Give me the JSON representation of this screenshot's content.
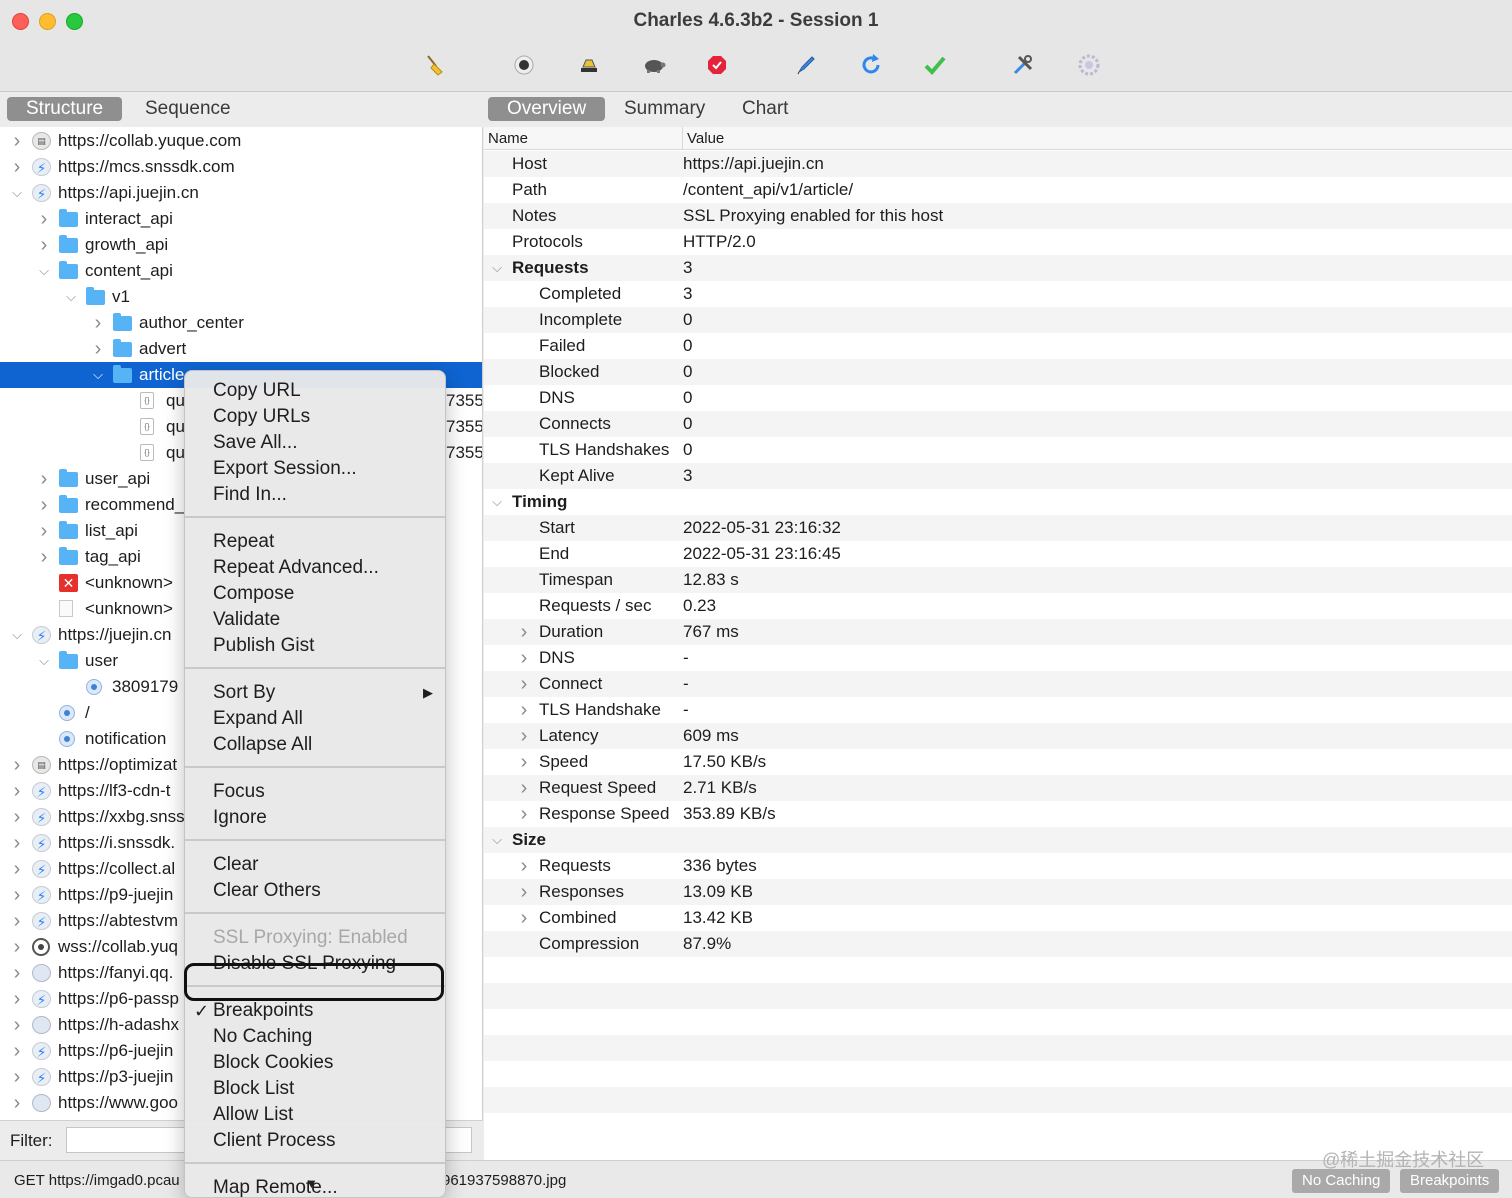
{
  "window": {
    "title": "Charles 4.6.3b2 - Session 1"
  },
  "toolbar": {
    "icons": [
      "broom-icon",
      "record-icon",
      "throttle-icon",
      "turtle-icon",
      "breakpoint-stop-icon",
      "pen-icon",
      "refresh-icon",
      "check-icon",
      "tools-icon",
      "gear-icon"
    ]
  },
  "left_tabs": [
    "Structure",
    "Sequence"
  ],
  "right_tabs": [
    "Overview",
    "Summary",
    "Chart"
  ],
  "tree": [
    {
      "label": "https://collab.yuque.com",
      "icon": "lock-icon",
      "level": 0,
      "chev": ">"
    },
    {
      "label": "https://mcs.snssdk.com",
      "icon": "bolt-icon",
      "level": 0,
      "chev": ">"
    },
    {
      "label": "https://api.juejin.cn",
      "icon": "bolt-icon",
      "level": 0,
      "chev": "v"
    },
    {
      "label": "interact_api",
      "icon": "folder-icon",
      "level": 1,
      "chev": ">"
    },
    {
      "label": "growth_api",
      "icon": "folder-icon",
      "level": 1,
      "chev": ">"
    },
    {
      "label": "content_api",
      "icon": "folder-icon",
      "level": 1,
      "chev": "v"
    },
    {
      "label": "v1",
      "icon": "folder-icon",
      "level": 2,
      "chev": "v"
    },
    {
      "label": "author_center",
      "icon": "folder-icon",
      "level": 3,
      "chev": ">"
    },
    {
      "label": "advert",
      "icon": "folder-icon",
      "level": 3,
      "chev": ">"
    },
    {
      "label": "article",
      "icon": "folder-icon",
      "level": 3,
      "chev": "v",
      "selected": true
    },
    {
      "label": "qu",
      "icon": "json-doc-icon",
      "level": 4,
      "chev": "",
      "trail": "7355"
    },
    {
      "label": "qu",
      "icon": "json-doc-icon",
      "level": 4,
      "chev": "",
      "trail": "7355"
    },
    {
      "label": "qu",
      "icon": "json-doc-icon",
      "level": 4,
      "chev": "",
      "trail": "7355"
    },
    {
      "label": "user_api",
      "icon": "folder-icon",
      "level": 1,
      "chev": ">"
    },
    {
      "label": "recommend_",
      "icon": "folder-icon",
      "level": 1,
      "chev": ">"
    },
    {
      "label": "list_api",
      "icon": "folder-icon",
      "level": 1,
      "chev": ">"
    },
    {
      "label": "tag_api",
      "icon": "folder-icon",
      "level": 1,
      "chev": ">"
    },
    {
      "label": "<unknown>",
      "icon": "error-icon",
      "level": 1,
      "chev": ""
    },
    {
      "label": "<unknown>",
      "icon": "blank-doc-icon",
      "level": 1,
      "chev": ""
    },
    {
      "label": "https://juejin.cn",
      "icon": "bolt-icon",
      "level": 0,
      "chev": "v"
    },
    {
      "label": "user",
      "icon": "folder-icon",
      "level": 1,
      "chev": "v"
    },
    {
      "label": "3809179",
      "icon": "request-dot-icon",
      "level": 2,
      "chev": ""
    },
    {
      "label": "/",
      "icon": "request-dot-icon",
      "level": 1,
      "chev": ""
    },
    {
      "label": "notification",
      "icon": "request-dot-icon",
      "level": 1,
      "chev": ""
    },
    {
      "label": "https://optimizat",
      "icon": "lock-icon",
      "level": 0,
      "chev": ">"
    },
    {
      "label": "https://lf3-cdn-t",
      "icon": "bolt-icon",
      "level": 0,
      "chev": ">"
    },
    {
      "label": "https://xxbg.snss",
      "icon": "bolt-icon",
      "level": 0,
      "chev": ">"
    },
    {
      "label": "https://i.snssdk.",
      "icon": "bolt-icon",
      "level": 0,
      "chev": ">"
    },
    {
      "label": "https://collect.al",
      "icon": "bolt-icon",
      "level": 0,
      "chev": ">"
    },
    {
      "label": "https://p9-juejin",
      "icon": "bolt-icon",
      "level": 0,
      "chev": ">"
    },
    {
      "label": "https://abtestvm",
      "icon": "bolt-icon",
      "level": 0,
      "chev": ">"
    },
    {
      "label": "wss://collab.yuq",
      "icon": "websocket-icon",
      "level": 0,
      "chev": ">"
    },
    {
      "label": "https://fanyi.qq.",
      "icon": "globe-icon",
      "level": 0,
      "chev": ">"
    },
    {
      "label": "https://p6-passp",
      "icon": "bolt-icon",
      "level": 0,
      "chev": ">"
    },
    {
      "label": "https://h-adashx",
      "icon": "globe-icon",
      "level": 0,
      "chev": ">"
    },
    {
      "label": "https://p6-juejin",
      "icon": "bolt-icon",
      "level": 0,
      "chev": ">"
    },
    {
      "label": "https://p3-juejin",
      "icon": "bolt-icon",
      "level": 0,
      "chev": ">"
    },
    {
      "label": "https://www.goo",
      "icon": "globe-icon",
      "level": 0,
      "chev": ">"
    }
  ],
  "filter": {
    "label": "Filter:",
    "value": ""
  },
  "overview": {
    "col_name": "Name",
    "col_value": "Value",
    "rows": [
      {
        "name": "Host",
        "value": "https://api.juejin.cn",
        "level": 0
      },
      {
        "name": "Path",
        "value": "/content_api/v1/article/",
        "level": 0
      },
      {
        "name": "Notes",
        "value": "SSL Proxying enabled for this host",
        "level": 0
      },
      {
        "name": "Protocols",
        "value": "HTTP/2.0",
        "level": 0
      },
      {
        "name": "Requests",
        "value": "3",
        "level": 0,
        "group": true,
        "chev": "v"
      },
      {
        "name": "Completed",
        "value": "3",
        "level": 1
      },
      {
        "name": "Incomplete",
        "value": "0",
        "level": 1
      },
      {
        "name": "Failed",
        "value": "0",
        "level": 1
      },
      {
        "name": "Blocked",
        "value": "0",
        "level": 1
      },
      {
        "name": "DNS",
        "value": "0",
        "level": 1
      },
      {
        "name": "Connects",
        "value": "0",
        "level": 1
      },
      {
        "name": "TLS Handshakes",
        "value": "0",
        "level": 1
      },
      {
        "name": "Kept Alive",
        "value": "3",
        "level": 1
      },
      {
        "name": "Timing",
        "value": "",
        "level": 0,
        "group": true,
        "chev": "v"
      },
      {
        "name": "Start",
        "value": "2022-05-31 23:16:32",
        "level": 1
      },
      {
        "name": "End",
        "value": "2022-05-31 23:16:45",
        "level": 1
      },
      {
        "name": "Timespan",
        "value": "12.83 s",
        "level": 1
      },
      {
        "name": "Requests / sec",
        "value": "0.23",
        "level": 1
      },
      {
        "name": "Duration",
        "value": "767 ms",
        "level": 1,
        "chev": ">"
      },
      {
        "name": "DNS",
        "value": "-",
        "level": 1,
        "chev": ">"
      },
      {
        "name": "Connect",
        "value": "-",
        "level": 1,
        "chev": ">"
      },
      {
        "name": "TLS Handshake",
        "value": "-",
        "level": 1,
        "chev": ">"
      },
      {
        "name": "Latency",
        "value": "609 ms",
        "level": 1,
        "chev": ">"
      },
      {
        "name": "Speed",
        "value": "17.50 KB/s",
        "level": 1,
        "chev": ">"
      },
      {
        "name": "Request Speed",
        "value": "2.71 KB/s",
        "level": 1,
        "chev": ">"
      },
      {
        "name": "Response Speed",
        "value": "353.89 KB/s",
        "level": 1,
        "chev": ">"
      },
      {
        "name": "Size",
        "value": "",
        "level": 0,
        "group": true,
        "chev": "v"
      },
      {
        "name": "Requests",
        "value": "336 bytes",
        "level": 1,
        "chev": ">"
      },
      {
        "name": "Responses",
        "value": "13.09 KB",
        "level": 1,
        "chev": ">"
      },
      {
        "name": "Combined",
        "value": "13.42 KB",
        "level": 1,
        "chev": ">"
      },
      {
        "name": "Compression",
        "value": "87.9%",
        "level": 1
      }
    ]
  },
  "context_menu": {
    "groups": [
      [
        "Copy URL",
        "Copy URLs",
        "Save All...",
        "Export Session...",
        "Find In..."
      ],
      [
        "Repeat",
        "Repeat Advanced...",
        "Compose",
        "Validate",
        "Publish Gist"
      ],
      [
        "Sort By",
        "Expand All",
        "Collapse All"
      ],
      [
        "Focus",
        "Ignore"
      ],
      [
        "Clear",
        "Clear Others"
      ],
      [
        "SSL Proxying: Enabled",
        "Disable SSL Proxying"
      ],
      [
        "Breakpoints",
        "No Caching",
        "Block Cookies",
        "Block List",
        "Allow List",
        "Client Process"
      ],
      [
        "Map Remote..."
      ]
    ],
    "disabled": [
      "SSL Proxying: Enabled"
    ],
    "checked": [
      "Breakpoints"
    ],
    "submenu": [
      "Sort By"
    ]
  },
  "status": {
    "left": "GET https://imgad0.pcau",
    "right": "961937598870.jpg",
    "buttons": [
      "No Caching",
      "Breakpoints"
    ],
    "watermark": "@稀土掘金技术社区"
  },
  "colors": {
    "selection": "#0f64d2",
    "tab_active": "#8f8f8f",
    "folder": "#56b3f5"
  }
}
